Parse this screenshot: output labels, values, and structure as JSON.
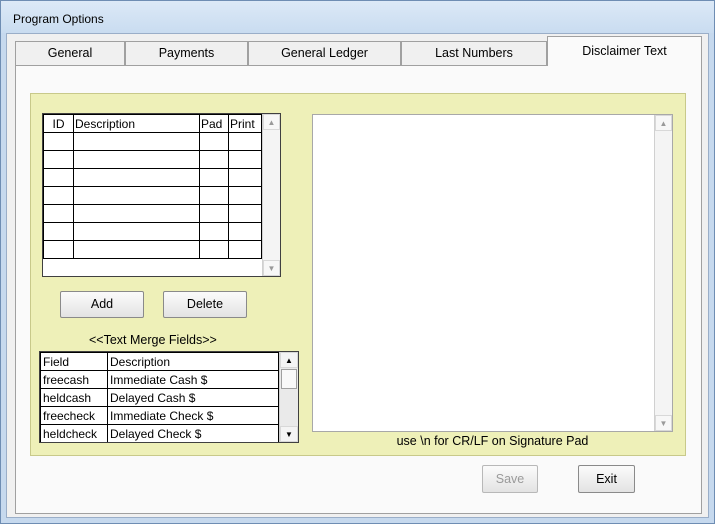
{
  "window": {
    "title": "Program Options"
  },
  "tabs": [
    {
      "label": "General"
    },
    {
      "label": "Payments"
    },
    {
      "label": "General Ledger"
    },
    {
      "label": "Last Numbers"
    },
    {
      "label": "Disclaimer Text"
    }
  ],
  "active_tab": "Disclaimer Text",
  "disclaimer_grid": {
    "columns": [
      "ID",
      "Description",
      "Pad",
      "Print"
    ],
    "rows": 7
  },
  "buttons": {
    "add": "Add",
    "delete": "Delete",
    "save": "Save",
    "exit": "Exit"
  },
  "merge_fields": {
    "caption": "<<Text Merge Fields>>",
    "columns": [
      "Field",
      "Description"
    ],
    "rows": [
      {
        "field": "freecash",
        "description": "Immediate Cash $"
      },
      {
        "field": "heldcash",
        "description": "Delayed Cash $"
      },
      {
        "field": "freecheck",
        "description": "Immediate Check $"
      },
      {
        "field": "heldcheck",
        "description": "Delayed Check $"
      }
    ]
  },
  "disclaimer_text": {
    "value": ""
  },
  "hint": "use \\n for CR/LF on Signature Pad",
  "colors": {
    "panel_bg": "#eef0b8",
    "window_frame": "#c6d9ee"
  },
  "icons": {
    "scroll_up": "triangle-up",
    "scroll_down": "triangle-down"
  }
}
